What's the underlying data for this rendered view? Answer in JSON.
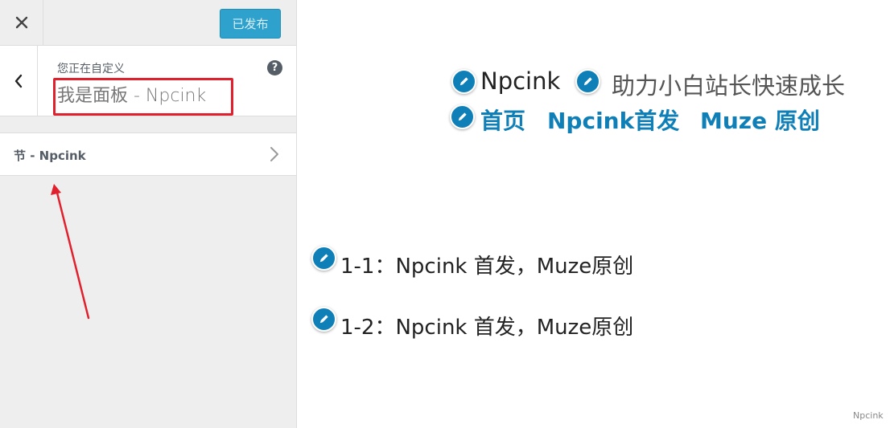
{
  "topbar": {
    "close_icon": "close-icon",
    "publish_label": "已发布"
  },
  "panel": {
    "customizing_label": "您正在自定义",
    "title": "我是面板 - Npcink",
    "back_icon": "chevron-left-icon",
    "help_icon": "help-icon",
    "help_glyph": "?"
  },
  "section": {
    "label": "节 - Npcink",
    "chevron_icon": "chevron-right-icon"
  },
  "preview": {
    "site_title": "Npcink",
    "site_description": "助力小白站长快速成长",
    "menu_items": [
      "首页",
      "Npcink首发",
      "Muze 原创"
    ],
    "posts": [
      "1-1：Npcink 首发，Muze原创",
      "1-2：Npcink 首发，Muze原创"
    ],
    "edit_icon": "pencil-icon"
  },
  "watermark": "Npcink",
  "colors": {
    "accent": "#0f7fb8",
    "publish_button": "#2ea2cc",
    "annotation_red": "#e0212d",
    "sidebar_bg": "#eeeeee"
  }
}
